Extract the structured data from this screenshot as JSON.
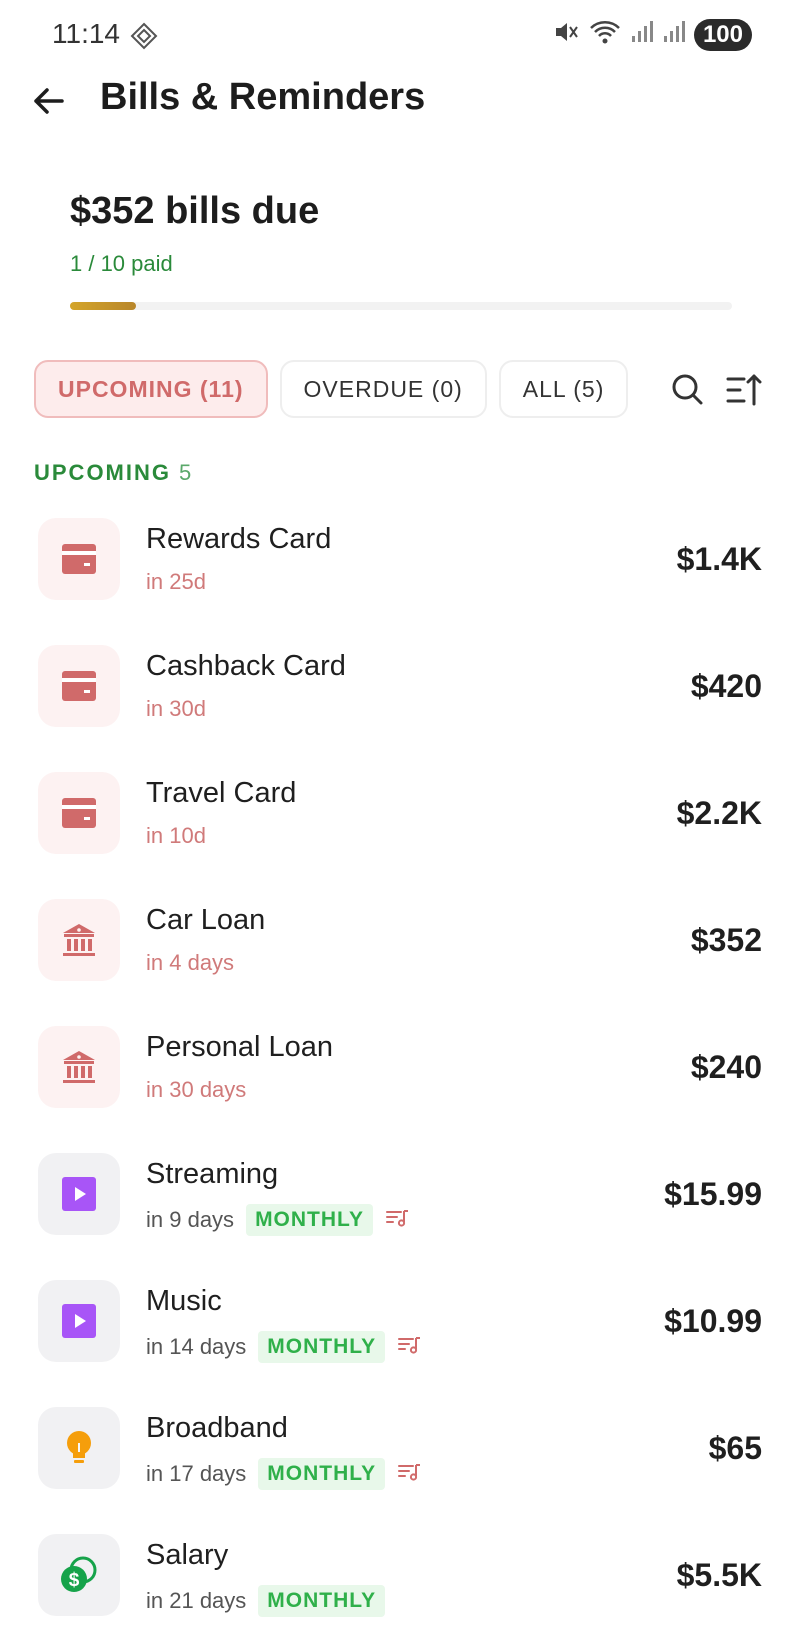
{
  "status": {
    "time": "11:14",
    "battery": "100"
  },
  "header": {
    "title": "Bills & Reminders"
  },
  "summary": {
    "amount_text": "$352 bills due",
    "paid_text": "1 / 10 paid",
    "progress_fraction": 0.1
  },
  "tabs": [
    {
      "label": "UPCOMING (11)",
      "active": true
    },
    {
      "label": "OVERDUE (0)",
      "active": false
    },
    {
      "label": "ALL (5)",
      "active": false
    }
  ],
  "section": {
    "label": "UPCOMING",
    "count": "5"
  },
  "colors": {
    "accent_red": "#d06a6a",
    "green": "#2a8a3a",
    "badge_green": "#2fb04a",
    "progress_gold": "#c9972a",
    "purple": "#a855f7",
    "orange": "#f59e0b",
    "teal": "#16a34a"
  },
  "bills": [
    {
      "name": "Rewards Card",
      "due": "in 25d",
      "amount": "$1.4K",
      "icon": "credit-card-icon",
      "theme": "red"
    },
    {
      "name": "Cashback Card",
      "due": "in 30d",
      "amount": "$420",
      "icon": "credit-card-icon",
      "theme": "red"
    },
    {
      "name": "Travel Card",
      "due": "in 10d",
      "amount": "$2.2K",
      "icon": "credit-card-icon",
      "theme": "red"
    },
    {
      "name": "Car Loan",
      "due": "in 4 days",
      "amount": "$352",
      "icon": "bank-icon",
      "theme": "red"
    },
    {
      "name": "Personal Loan",
      "due": "in 30 days",
      "amount": "$240",
      "icon": "bank-icon",
      "theme": "red"
    },
    {
      "name": "Streaming",
      "due": "in 9 days",
      "amount": "$15.99",
      "icon": "play-icon",
      "theme": "gray",
      "frequency": "MONTHLY",
      "recurring": true
    },
    {
      "name": "Music",
      "due": "in 14 days",
      "amount": "$10.99",
      "icon": "play-icon",
      "theme": "gray",
      "frequency": "MONTHLY",
      "recurring": true
    },
    {
      "name": "Broadband",
      "due": "in 17 days",
      "amount": "$65",
      "icon": "lightbulb-icon",
      "theme": "gray",
      "frequency": "MONTHLY",
      "recurring": true
    },
    {
      "name": "Salary",
      "due": "in 21 days",
      "amount": "$5.5K",
      "icon": "money-icon",
      "theme": "gray",
      "frequency": "MONTHLY",
      "recurring": false
    }
  ]
}
